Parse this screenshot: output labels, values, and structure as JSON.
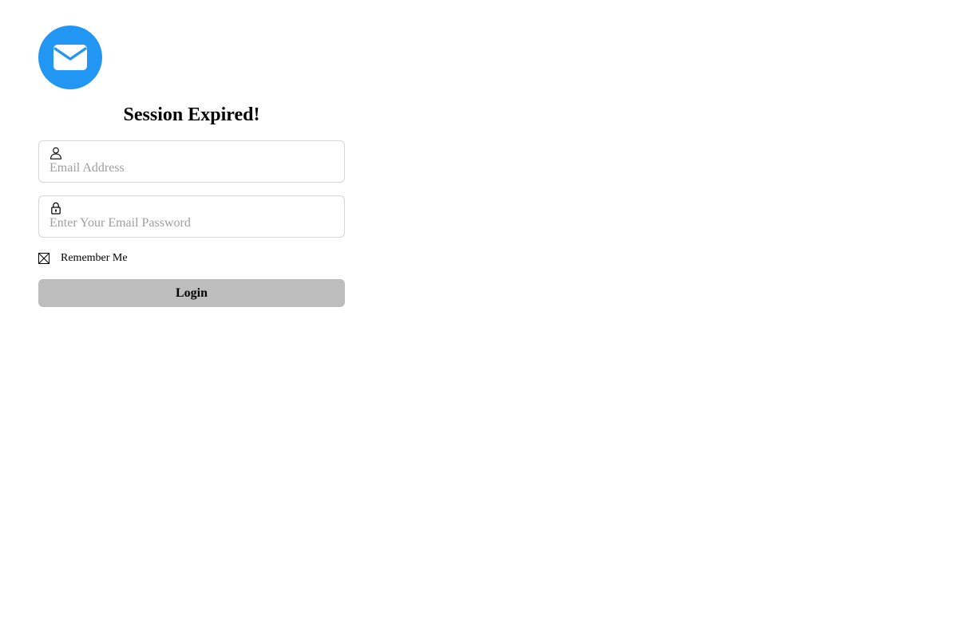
{
  "logo": {
    "icon": "envelope-icon",
    "background_color": "#2196f3"
  },
  "title": "Session Expired!",
  "email_field": {
    "icon": "user-icon",
    "placeholder": "Email Address",
    "value": ""
  },
  "password_field": {
    "icon": "lock-icon",
    "placeholder": "Enter Your Email Password",
    "value": ""
  },
  "remember": {
    "label": "Remember Me"
  },
  "login_button": {
    "label": "Login",
    "background_color": "#bdbdbd"
  }
}
